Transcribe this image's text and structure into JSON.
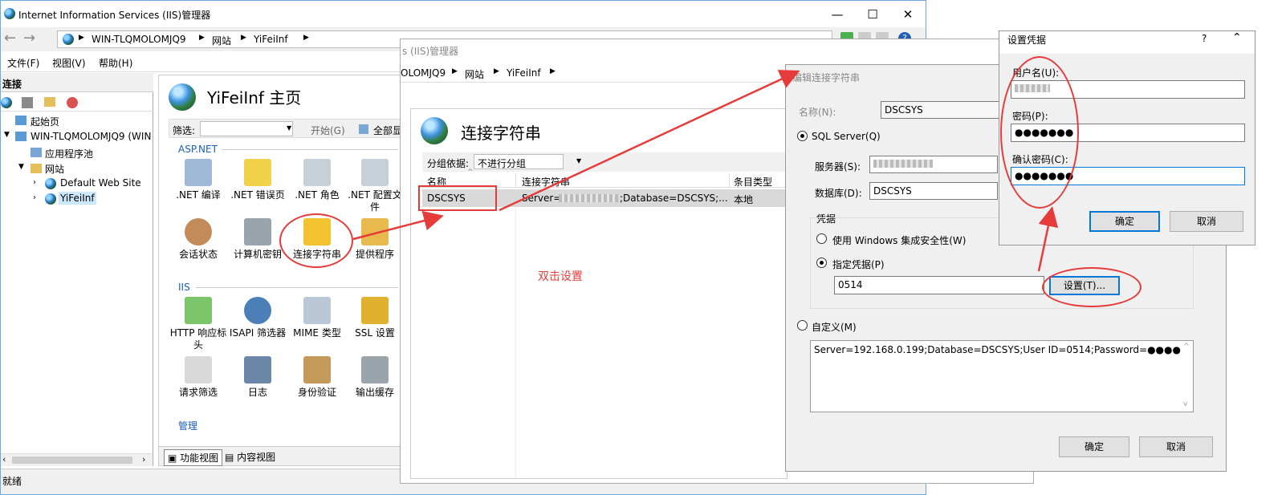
{
  "iis_main": {
    "title": "Internet Information Services (IIS)管理器",
    "address": [
      "WIN-TLQMOLOMJQ9",
      "网站",
      "YiFeiInf"
    ],
    "menu": [
      "文件(F)",
      "视图(V)",
      "帮助(H)"
    ],
    "connections_title": "连接",
    "tree": [
      "起始页",
      "WIN-TLQMOLOMJQ9 (WIN",
      "应用程序池",
      "网站",
      "Default Web Site",
      "YiFeiInf"
    ],
    "page_title": "YiFeiInf 主页",
    "filter_label": "筛选:",
    "filter_start": "开始(G)",
    "filter_all": "全部显",
    "section_aspnet": "ASP.NET",
    "section_iis": "IIS",
    "section_manage": "管理",
    "col_i": "I",
    "features_aspnet": [
      ".NET 编译",
      ".NET 错误页",
      ".NET 角色",
      ".NET 配置文件",
      "会话状态",
      "计算机密钥",
      "连接字符串",
      "提供程序"
    ],
    "features_iis": [
      "HTTP 响应标头",
      "ISAPI 筛选器",
      "MIME 类型",
      "SSL 设置",
      "请求筛选",
      "日志",
      "身份验证",
      "输出缓存"
    ],
    "tab_features": "功能视图",
    "tab_content": "内容视图",
    "status": "就绪",
    "window_buttons": [
      "—",
      "☐",
      "✕"
    ]
  },
  "iis_second": {
    "title_partial": "s (IIS)管理器",
    "address": [
      "OLOMJQ9",
      "网站",
      "YiFeiInf"
    ],
    "page_title": "连接字符串",
    "group_by_label": "分组依据:",
    "group_by_value": "不进行分组",
    "columns": [
      "名称",
      "连接字符串",
      "条目类型"
    ],
    "row": {
      "name": "DSCSYS",
      "conn_prefix": "Server=",
      "conn_suffix": ";Database=DSCSYS;...",
      "type": "本地"
    },
    "annotation": "双击设置"
  },
  "edit_dialog": {
    "title": "编辑连接字符串",
    "name_label": "名称(N):",
    "name_value": "DSCSYS",
    "sql_server_label": "SQL Server(Q)",
    "server_label": "服务器(S):",
    "database_label": "数据库(D):",
    "database_value": "DSCSYS",
    "credentials_label": "凭据",
    "windows_auth_label": "使用 Windows 集成安全性(W)",
    "specify_label": "指定凭据(P)",
    "credential_value": "0514",
    "set_button": "设置(T)...",
    "custom_label": "自定义(M)",
    "custom_value": "Server=192.168.0.199;Database=DSCSYS;User ID=0514;Password=●●●●",
    "ok": "确定",
    "cancel": "取消"
  },
  "cred_dialog": {
    "title": "设置凭据",
    "help": "?",
    "user_label": "用户名(U):",
    "password_label": "密码(P):",
    "password_value": "●●●●●●●",
    "confirm_label": "确认密码(C):",
    "confirm_value": "●●●●●●●",
    "ok": "确定",
    "cancel": "取消"
  },
  "colors": {
    "annotation_red": "#e63b3b",
    "selection": "#cce8ff",
    "accent": "#0078d7"
  }
}
